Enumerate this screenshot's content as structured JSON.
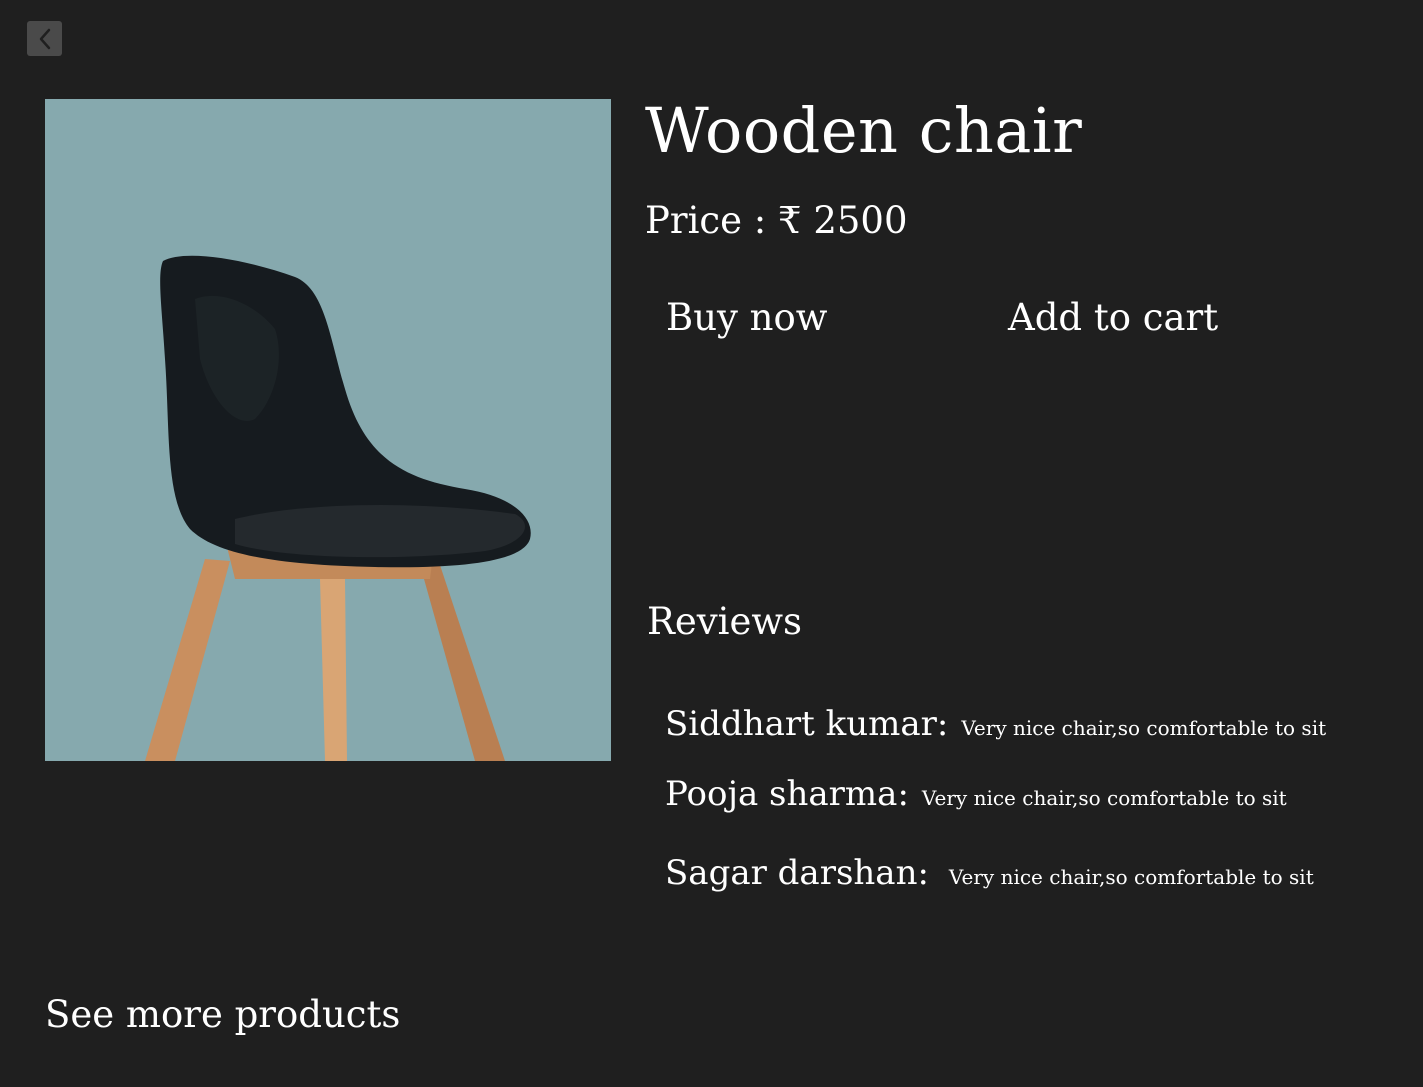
{
  "nav": {
    "back_icon": "chevron-left-icon"
  },
  "product": {
    "title": "Wooden chair",
    "price_label": "Price : ₹ 2500",
    "image_alt": "Black chair with wooden legs"
  },
  "actions": {
    "buy_label": "Buy now",
    "cart_label": "Add to cart"
  },
  "reviews": {
    "heading": "Reviews",
    "items": [
      {
        "name": "Siddhart kumar:",
        "text": "Very nice chair,so comfortable to sit"
      },
      {
        "name": "Pooja sharma:",
        "text": "Very nice chair,so comfortable to sit"
      },
      {
        "name": "Sagar darshan:",
        "text": "Very nice chair,so comfortable to sit"
      }
    ]
  },
  "footer": {
    "see_more_label": "See more products"
  },
  "colors": {
    "background": "#1f1f1f",
    "image_background": "#86a9ae",
    "text": "#ffffff",
    "back_button": "#4a4a4a"
  }
}
